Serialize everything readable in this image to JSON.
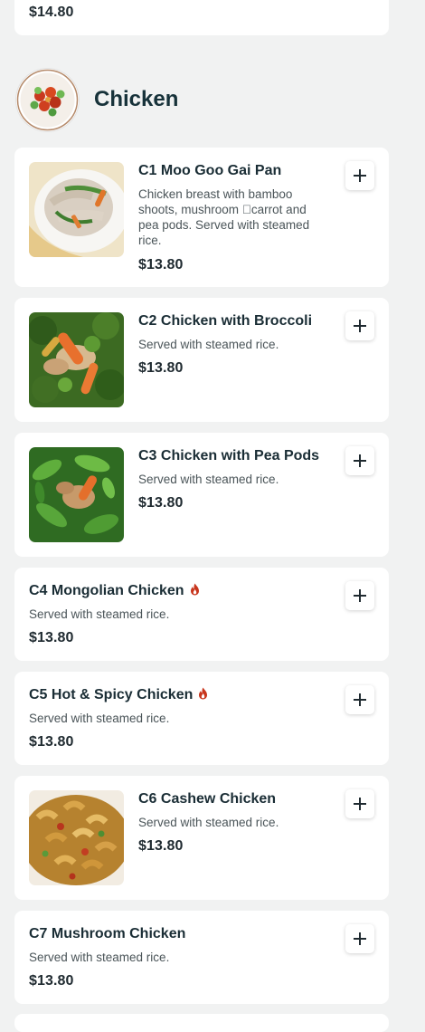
{
  "previous_item": {
    "price": "$14.80"
  },
  "section": {
    "title": "Chicken"
  },
  "items": [
    {
      "name": "C1 Moo Goo Gai Pan",
      "description": "Chicken breast with bamboo shoots, mushroom \u0000carrot and pea pods. Served with steamed rice.",
      "price": "$13.80",
      "has_image": true,
      "spicy": false
    },
    {
      "name": "C2 Chicken with Broccoli",
      "description": "Served with steamed rice.",
      "price": "$13.80",
      "has_image": true,
      "spicy": false
    },
    {
      "name": "C3 Chicken with Pea Pods",
      "description": "Served with steamed rice.",
      "price": "$13.80",
      "has_image": true,
      "spicy": false
    },
    {
      "name": "C4 Mongolian Chicken",
      "description": "Served with steamed rice.",
      "price": "$13.80",
      "has_image": false,
      "spicy": true
    },
    {
      "name": "C5 Hot & Spicy Chicken",
      "description": "Served with steamed rice.",
      "price": "$13.80",
      "has_image": false,
      "spicy": true
    },
    {
      "name": "C6 Cashew Chicken",
      "description": "Served with steamed rice.",
      "price": "$13.80",
      "has_image": true,
      "spicy": false
    },
    {
      "name": "C7 Mushroom Chicken",
      "description": "Served with steamed rice.",
      "price": "$13.80",
      "has_image": false,
      "spicy": false
    }
  ],
  "icons": {
    "add": "plus-icon",
    "spicy": "flame-icon"
  },
  "colors": {
    "background": "#f1f2f2",
    "card": "#ffffff",
    "text_primary": "#1f2a30",
    "section_title": "#17323a",
    "spicy": "#c8361d"
  }
}
